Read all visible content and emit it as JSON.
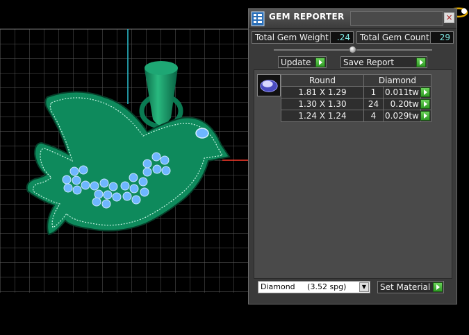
{
  "panel": {
    "title": "GEM REPORTER",
    "close_glyph": "×",
    "total_weight_label": "Total Gem Weight",
    "total_weight_value": ".24",
    "total_count_label": "Total Gem Count",
    "total_count_value": "29",
    "update_label": "Update",
    "save_report_label": "Save Report",
    "table": {
      "headers": [
        "Round",
        "Diamond"
      ],
      "rows": [
        {
          "size": "1.81 X 1.29",
          "count": "1",
          "weight": "0.011tw"
        },
        {
          "size": "1.30 X 1.30",
          "count": "24",
          "weight": "0.20tw"
        },
        {
          "size": "1.24 X 1.24",
          "count": "4",
          "weight": "0.029tw"
        }
      ]
    },
    "material": {
      "name": "Diamond",
      "spg": "(3.52 spg)"
    },
    "set_material_label": "Set Material"
  },
  "colors": {
    "model": "#0e8a5c",
    "gem": "#6eb6ff",
    "axis_red": "#ff3a2a",
    "axis_cyan": "#2bc0d0"
  },
  "icons": [
    "report-icon",
    "close-icon",
    "play-icon",
    "gem-thumbnail-icon",
    "dropdown-arrow-icon",
    "ring-icon"
  ]
}
